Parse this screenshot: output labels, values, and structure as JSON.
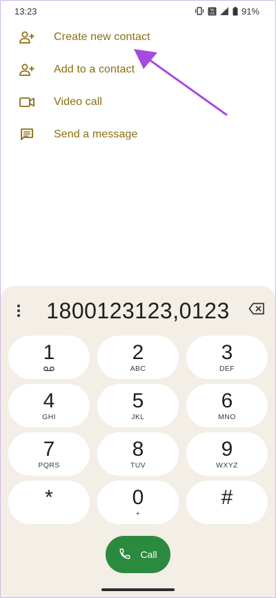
{
  "status_bar": {
    "time": "13:23",
    "battery_text": "91%",
    "icons": [
      "vibrate-icon",
      "volte-icon",
      "signal-icon",
      "battery-icon"
    ]
  },
  "options": [
    {
      "label": "Create new contact",
      "icon": "add-person-icon"
    },
    {
      "label": "Add to a contact",
      "icon": "add-person-icon"
    },
    {
      "label": "Video call",
      "icon": "video-camera-icon"
    },
    {
      "label": "Send a message",
      "icon": "message-icon"
    }
  ],
  "dialer": {
    "number": "1800123123,0123",
    "keys": [
      {
        "digit": "1",
        "letters": "",
        "sub_icon": "voicemail-icon"
      },
      {
        "digit": "2",
        "letters": "ABC"
      },
      {
        "digit": "3",
        "letters": "DEF"
      },
      {
        "digit": "4",
        "letters": "GHI"
      },
      {
        "digit": "5",
        "letters": "JKL"
      },
      {
        "digit": "6",
        "letters": "MNO"
      },
      {
        "digit": "7",
        "letters": "PQRS"
      },
      {
        "digit": "8",
        "letters": "TUV"
      },
      {
        "digit": "9",
        "letters": "WXYZ"
      },
      {
        "digit": "*",
        "letters": ""
      },
      {
        "digit": "0",
        "letters": "+"
      },
      {
        "digit": "#",
        "letters": ""
      }
    ],
    "call_label": "Call"
  },
  "colors": {
    "option_text": "#8a6d10",
    "dialer_background": "#f3eee6",
    "call_button": "#2a8a3e",
    "annotation_arrow": "#a64ae0"
  }
}
